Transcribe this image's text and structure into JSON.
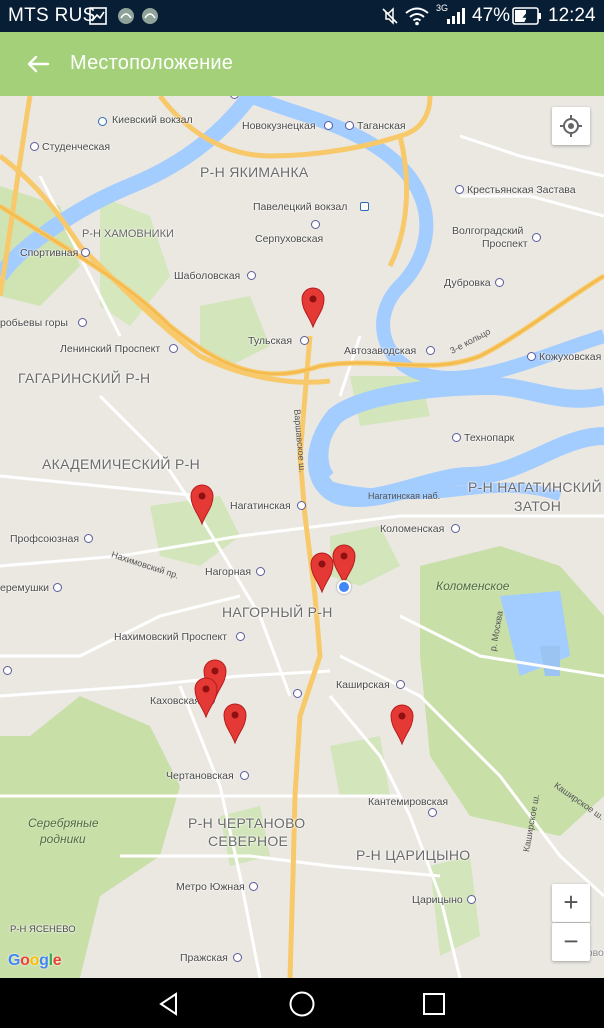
{
  "status_bar": {
    "carrier": "MTS RUS",
    "network": "3G",
    "battery": "47%",
    "time": "12:24"
  },
  "app_bar": {
    "title": "Местоположение"
  },
  "map": {
    "districts": {
      "yakimanka": "Р-Н ЯКИМАНКА",
      "khamovniki": "Р-Н ХАМОВНИКИ",
      "gagarinsky": "ГАГАРИНСКИЙ Р-Н",
      "akademichesky": "АКАДЕМИЧЕСКИЙ Р-Н",
      "nagatinsky_1": "Р-Н НАГАТИНСКИЙ",
      "nagatinsky_2": "ЗАТОН",
      "nagorny": "НАГОРНЫЙ Р-Н",
      "chertanovo_1": "Р-Н ЧЕРТАНОВО",
      "chertanovo_2": "СЕВЕРНОЕ",
      "tsaritsyno": "Р-Н ЦАРИЦЫНО",
      "yasenevo": "Р-Н ЯСЕНЕВО"
    },
    "parks": {
      "kolomenskoe": "Коломенское",
      "serebryanye_1": "Серебряные",
      "serebryanye_2": "родники"
    },
    "stations": {
      "kievsky": "Киевский вокзал",
      "studencheskaya": "Студенческая",
      "novokuznetskaya": "Новокузнецкая",
      "taganskaya": "Таганская",
      "krestyanskaya": "Крестьянская Застава",
      "paveletsky": "Павелецкий вокзал",
      "serpukhovskaya": "Серпуховская",
      "volgogradsky_1": "Волгоградский",
      "volgogradsky_2": "Проспект",
      "sportivnaya": "Спортивная",
      "shabolovskaya": "Шаболовская",
      "dubrovka": "Дубровка",
      "vorobyovy": "робьевы горы",
      "leninsky": "Ленинский Проспект",
      "tulskaya": "Тульская",
      "avtozavodskaya": "Автозаводская",
      "kozhukhovskaya": "Кожуховская",
      "tekhnopark": "Технопарк",
      "nagatinskaya": "Нагатинская",
      "profsoyuznaya": "Профсоюзная",
      "kolomenskaya": "Коломенская",
      "cheremushki": "еремушки",
      "nagornaya": "Нагорная",
      "nakhimovsky": "Нахимовский Проспект",
      "kashirskaya": "Каширская",
      "kakhovskaya": "Каховская",
      "chertanovskaya": "Чертановская",
      "kantemirovskaya": "Кантемировская",
      "tsaritsyno": "Царицыно",
      "metro_yuzhnaya": "Метро Южная",
      "prazhskaya": "Пражская",
      "orekhovo": "Орехово"
    },
    "road_labels": {
      "ttk": "3-е кольцо",
      "varshavskoe": "Варшавское ш.",
      "nakhimovsky_pr": "Нахимовский пр.",
      "nagatinskaya_nab": "Нагатинская наб.",
      "kashirskoe": "Каширское ш.",
      "kashirskoe_2": "Каширское ш.",
      "moskva_river": "р. Москва"
    },
    "google": [
      "G",
      "o",
      "o",
      "g",
      "l",
      "e"
    ],
    "controls": {
      "zoom_in": "+",
      "zoom_out": "−"
    }
  },
  "colors": {
    "status_bar": "#081e35",
    "app_bar": "#a4d07a",
    "water": "#a3ccff",
    "park": "#c8dfa8",
    "major_road": "#f8c96a",
    "marker": "#e53935",
    "location": "#4285f4"
  }
}
